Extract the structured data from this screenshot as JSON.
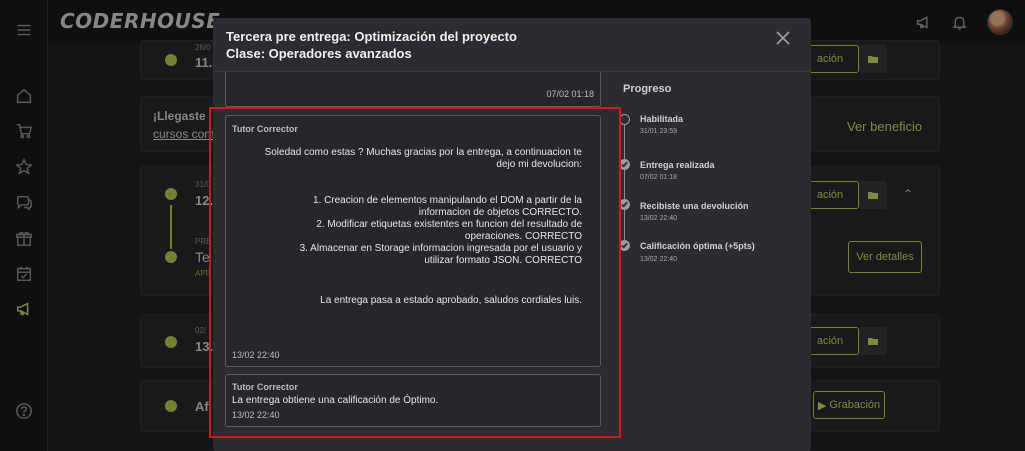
{
  "brand": "CODERHOUSE",
  "background": {
    "row1": {
      "date": "26/0",
      "title": "11.",
      "btn": "ación"
    },
    "promo": {
      "line1": "¡Llegaste",
      "line2": "cursos com",
      "link": "Ver beneficio"
    },
    "row2": {
      "date": "31/0",
      "title": "12.",
      "btn": "ación"
    },
    "row3": {
      "pre": "PRE",
      "title": "Te",
      "status": "APR",
      "btn": "Ver detalles"
    },
    "row4": {
      "date": "02/",
      "title": "13.",
      "btn": "ación"
    },
    "row5": {
      "title": "Af",
      "btn": "Grabación"
    }
  },
  "modal": {
    "title": "Tercera pre entrega: Optimización del proyecto",
    "subtitle": "Clase: Operadores avanzados",
    "prev_time": "07/02 01:18",
    "messages": [
      {
        "author": "Tutor Corrector",
        "lines": [
          "Soledad como estas ? Muchas gracias por la entrega, a continuacion te",
          "dejo mi devolucion:",
          "",
          "",
          "1. Creacion de elementos manipulando el DOM a partir de la",
          "informacion de objetos CORRECTO.",
          "2. Modificar etiquetas existentes en funcion del resultado de",
          "operaciones. CORRECTO",
          "3. Almacenar en Storage informacion ingresada por el usuario y",
          "utilizar formato JSON. CORRECTO",
          "",
          "",
          "",
          "La entrega pasa a estado aprobado, saludos cordiales luis."
        ],
        "time": "13/02 22:40"
      },
      {
        "author": "Tutor Corrector",
        "text": "La entrega obtiene una calificación de Óptimo.",
        "time": "13/02 22:40"
      }
    ],
    "progress": {
      "title": "Progreso",
      "steps": [
        {
          "label": "Habilitada",
          "time": "31/01 23:59"
        },
        {
          "label": "Entrega realizada",
          "time": "07/02 01:18"
        },
        {
          "label": "Recibiste una devolución",
          "time": "13/02 22:40"
        },
        {
          "label": "Calificación óptima (+5pts)",
          "time": "13/02 22:40"
        }
      ]
    }
  }
}
